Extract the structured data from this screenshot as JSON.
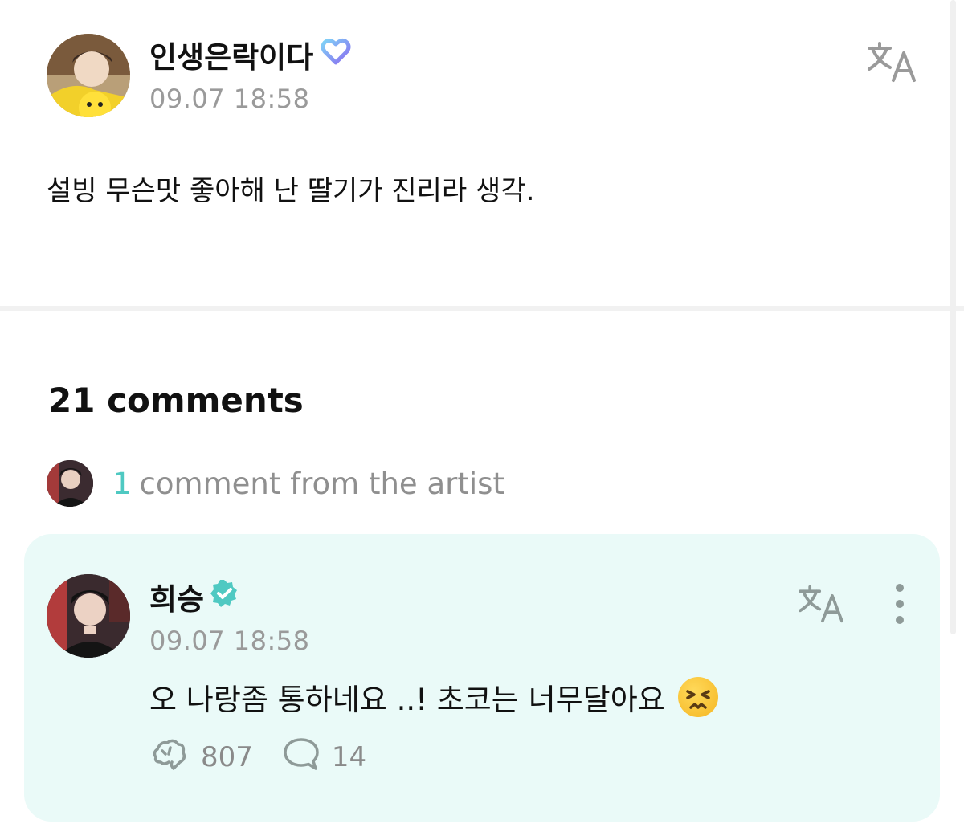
{
  "post": {
    "author": "인생은락이다",
    "timestamp": "09.07 18:58",
    "body": "설빙 무슨맛 좋아해 난 딸기가 진리라 생각."
  },
  "comments_header": {
    "count_label": "21 comments",
    "artist_count": "1",
    "artist_label": "comment from the artist"
  },
  "artist_comment": {
    "author": "희승",
    "timestamp": "09.07 18:58",
    "text": "오 나랑좀 통하네요 ..! 초코는 너무달아요",
    "emoji": "persevering-face",
    "likes": "807",
    "replies": "14"
  },
  "icons": {
    "post_badge": "fan-badge-heart-icon",
    "artist_badge": "verified-check-icon",
    "translate": "translate-icon",
    "more": "more-vertical-icon",
    "like": "like-icon",
    "reply": "reply-bubble-icon"
  },
  "colors": {
    "accent": "#4fc9c2",
    "card_bg": "#eafaf8",
    "muted_text": "#9a9a9a"
  }
}
